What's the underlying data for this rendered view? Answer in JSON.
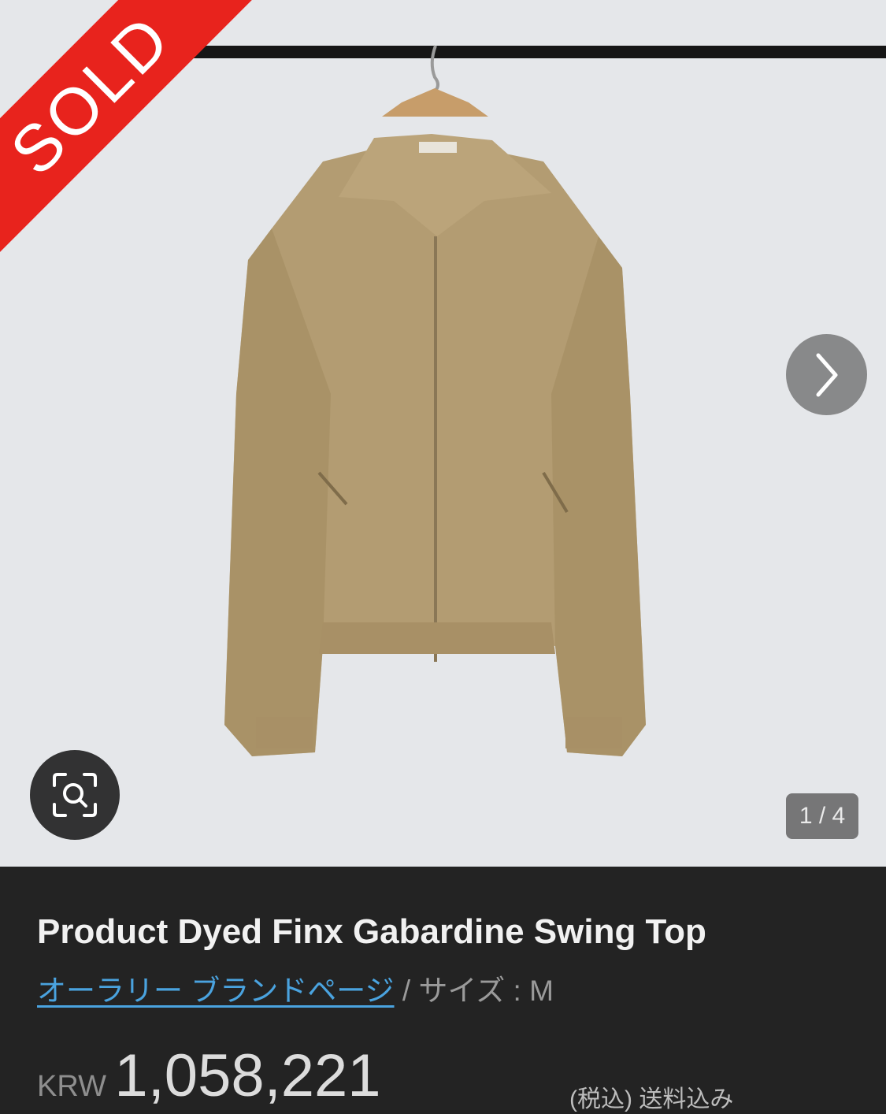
{
  "image": {
    "sold_label": "SOLD",
    "counter": "1 / 4",
    "background_color": "#e5e7ea",
    "jacket_color": "#b39c72"
  },
  "controls": {
    "next_icon": "chevron-right-icon",
    "zoom_icon": "image-search-icon"
  },
  "product": {
    "title": "Product Dyed Finx Gabardine Swing Top",
    "brand_link": "オーラリー ブランドページ",
    "separator": " / ",
    "size_label": "サイズ : M",
    "currency": "KRW",
    "price": "1,058,221",
    "tax_note": "(税込) 送料込み"
  },
  "colors": {
    "sold_red": "#e8231d",
    "link_blue": "#4aa3df",
    "panel_bg": "#232323"
  }
}
